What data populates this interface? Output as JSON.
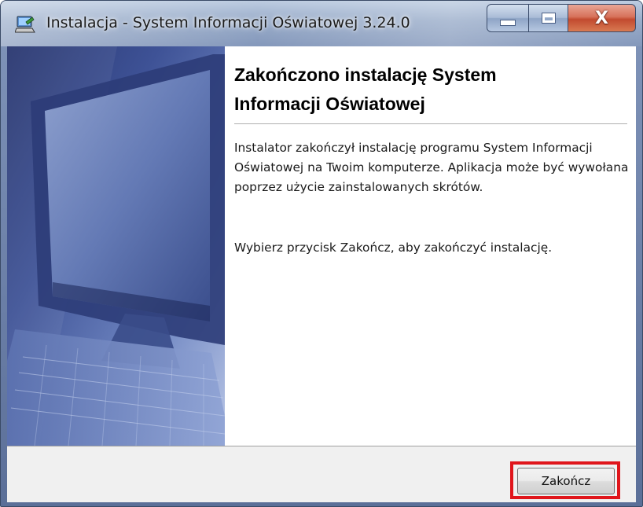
{
  "window": {
    "title": "Instalacja - System Informacji Oświatowej 3.24.0",
    "controls": {
      "minimize": "minimize-icon",
      "maximize": "maximize-icon",
      "close": "close-icon",
      "close_glyph": "X"
    }
  },
  "content": {
    "heading_line1": "Zakończono instalację System",
    "heading_line2": "Informacji Oświatowej",
    "paragraph1": "Instalator zakończył instalację programu System Informacji Oświatowej na Twoim komputerze. Aplikacja może być wywołana poprzez użycie zainstalowanych skrótów.",
    "paragraph2": "Wybierz przycisk Zakończ, aby zakończyć instalację."
  },
  "footer": {
    "finish_label": "Zakończ"
  },
  "colors": {
    "highlight": "#e0151b",
    "titlebar": "#93a7c6",
    "close_button": "#c24a2f"
  }
}
